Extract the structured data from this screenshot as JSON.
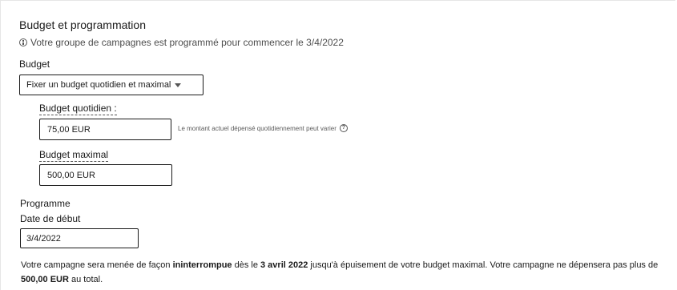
{
  "section": {
    "title": "Budget et programmation",
    "info_text": "Votre groupe de campagnes est programmé pour commencer le 3/4/2022"
  },
  "budget": {
    "label": "Budget",
    "type_selected": "Fixer un budget quotidien et maximal",
    "daily": {
      "label": "Budget quotidien :",
      "value": "75,00 EUR",
      "helper": "Le montant actuel dépensé quotidiennement peut varier"
    },
    "max": {
      "label": "Budget maximal",
      "value": "500,00 EUR"
    }
  },
  "schedule": {
    "label": "Programme",
    "start_label": "Date de début",
    "start_value": "3/4/2022"
  },
  "summary": {
    "part1": "Votre campagne sera menée de façon ",
    "bold1": "ininterrompue",
    "part2": " dès le ",
    "bold2": "3 avril 2022",
    "part3": " jusqu'à épuisement de votre budget maximal. Votre campagne ne dépensera pas plus de ",
    "bold3": "500,00 EUR",
    "part4": " au total."
  }
}
